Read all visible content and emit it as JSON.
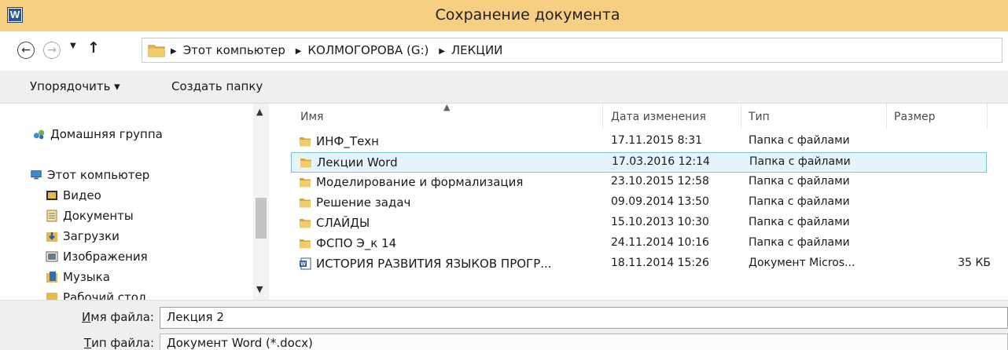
{
  "window": {
    "title": "Сохранение документа",
    "app_icon_letter": "W"
  },
  "address": {
    "crumbs": [
      "Этот компьютер",
      "КОЛМОГОРОВА (G:)",
      "ЛЕКЦИИ"
    ]
  },
  "toolbar": {
    "organize_label": "Упорядочить ▾",
    "new_folder_label": "Создать папку"
  },
  "nav": {
    "items": [
      {
        "label": "Домашняя группа",
        "icon": "homegroup-icon"
      },
      {
        "label": "Этот компьютер",
        "icon": "computer-icon"
      },
      {
        "label": "Видео",
        "icon": "video-icon"
      },
      {
        "label": "Документы",
        "icon": "documents-icon"
      },
      {
        "label": "Загрузки",
        "icon": "downloads-icon"
      },
      {
        "label": "Изображения",
        "icon": "images-icon"
      },
      {
        "label": "Музыка",
        "icon": "music-icon"
      },
      {
        "label": "Рабочий стол",
        "icon": "desktop-icon"
      }
    ]
  },
  "columns": {
    "name": "Имя",
    "date": "Дата изменения",
    "type": "Тип",
    "size": "Размер"
  },
  "files": [
    {
      "name": "ИНФ_Техн",
      "date": "17.11.2015 8:31",
      "type": "Папка с файлами",
      "size": "",
      "icon": "folder-icon"
    },
    {
      "name": "Лекции Word",
      "date": "17.03.2016 12:14",
      "type": "Папка с файлами",
      "size": "",
      "icon": "folder-icon",
      "selected": true
    },
    {
      "name": "Моделирование и формализация",
      "date": "23.10.2015 12:58",
      "type": "Папка с файлами",
      "size": "",
      "icon": "folder-icon"
    },
    {
      "name": "Решение задач",
      "date": "09.09.2014 13:50",
      "type": "Папка с файлами",
      "size": "",
      "icon": "folder-icon"
    },
    {
      "name": "СЛАЙДЫ",
      "date": "15.10.2013 10:30",
      "type": "Папка с файлами",
      "size": "",
      "icon": "folder-icon"
    },
    {
      "name": "ФСПО Э_к 14",
      "date": "24.11.2014 10:16",
      "type": "Папка с файлами",
      "size": "",
      "icon": "folder-icon"
    },
    {
      "name": "ИСТОРИЯ РАЗВИТИЯ ЯЗЫКОВ ПРОГР...",
      "date": "18.11.2014 15:26",
      "type": "Документ Micros...",
      "size": "35 КБ",
      "icon": "word-doc-icon"
    }
  ],
  "save": {
    "filename_label_u": "И",
    "filename_label_rest": "мя файла:",
    "filename_value": "Лекция 2",
    "filetype_label_u": "Т",
    "filetype_label_rest": "ип файла:",
    "filetype_value": "Документ Word (*.docx)"
  },
  "colors": {
    "titlebar": "#f6cf83",
    "selection_bg": "#e5f3fb",
    "selection_border": "#7ac0e9",
    "folder": "#e8b84a"
  }
}
